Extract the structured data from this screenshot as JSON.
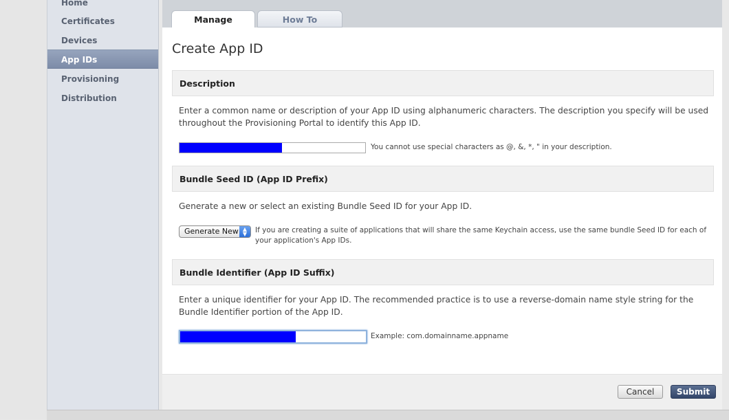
{
  "sidebar": {
    "items": [
      {
        "label": "Home"
      },
      {
        "label": "Certificates"
      },
      {
        "label": "Devices"
      },
      {
        "label": "App IDs"
      },
      {
        "label": "Provisioning"
      },
      {
        "label": "Distribution"
      }
    ],
    "active": "App IDs"
  },
  "tabs": [
    {
      "label": "Manage"
    },
    {
      "label": "How To"
    }
  ],
  "page_title": "Create App ID",
  "description_section": {
    "heading": "Description",
    "text": "Enter a common name or description of your App ID using alphanumeric characters. The description you specify will be used throughout the Provisioning Portal to identify this App ID.",
    "hint": "You cannot use special characters as @, &, *, \" in your description."
  },
  "seed_section": {
    "heading": "Bundle Seed ID (App ID Prefix)",
    "text": "Generate a new or select an existing Bundle Seed ID for your App ID.",
    "select_value": "Generate New",
    "hint": "If you are creating a suite of applications that will share the same Keychain access, use the same bundle Seed ID for each of your application's App IDs."
  },
  "identifier_section": {
    "heading": "Bundle Identifier (App ID Suffix)",
    "text": "Enter a unique identifier for your App ID. The recommended practice is to use a reverse-domain name style string for the Bundle Identifier portion of the App ID.",
    "hint": "Example: com.domainname.appname"
  },
  "buttons": {
    "cancel": "Cancel",
    "submit": "Submit"
  },
  "colors": {
    "redaction_fill": "#0000ff",
    "active_nav": "#8a99b3",
    "submit_button": "#3b4e72"
  }
}
